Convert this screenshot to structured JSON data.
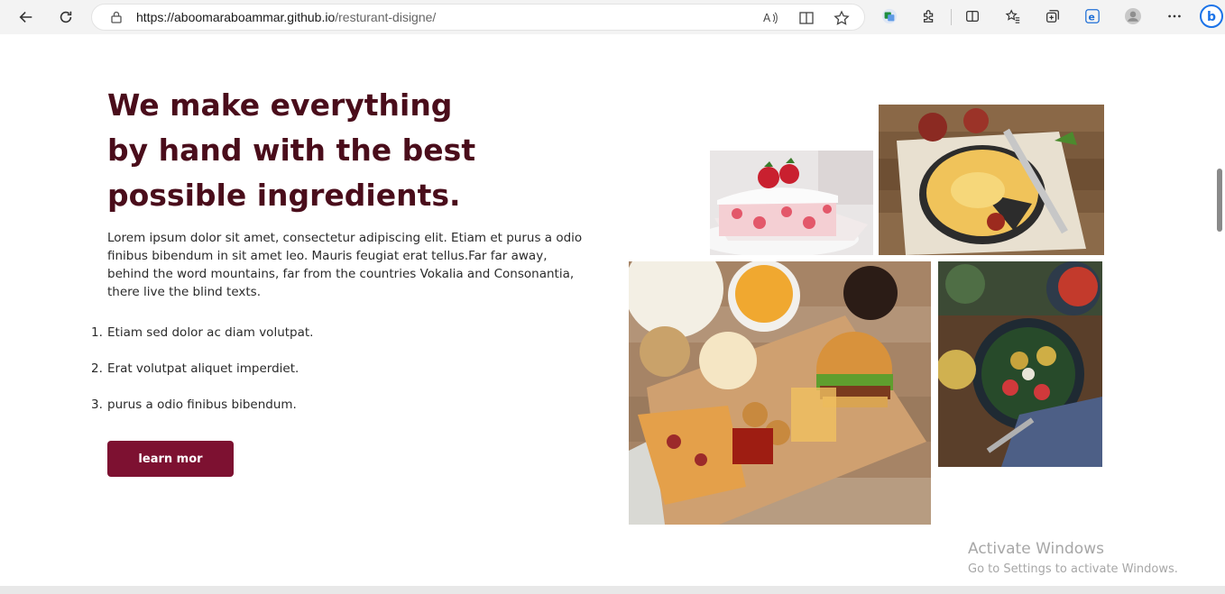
{
  "browser": {
    "url_host": "https://aboomaraboammar.github.io",
    "url_path": "/resturant-disigne/",
    "icons": [
      "back-icon",
      "refresh-icon",
      "lock-icon",
      "read-aloud-icon",
      "immersive-reader-icon",
      "favorite-star-icon",
      "translate-icon",
      "extensions-icon",
      "split-screen-icon",
      "favorites-icon",
      "collections-icon",
      "edge-icon",
      "profile-icon",
      "more-icon",
      "bing-icon"
    ]
  },
  "content": {
    "heading": "We make everything by hand with the best possible ingredients.",
    "paragraph": "Lorem ipsum dolor sit amet, consectetur adipiscing elit. Etiam et purus a odio finibus bibendum in sit amet leo. Mauris feugiat erat tellus.Far far away, behind the word mountains, far from the countries Vokalia and Consonantia, there live the blind texts.",
    "list": [
      {
        "num": "1.",
        "text": "Etiam sed dolor ac diam volutpat."
      },
      {
        "num": "2.",
        "text": "Erat volutpat aliquet imperdiet."
      },
      {
        "num": "3.",
        "text": "purus a odio finibus bibendum."
      }
    ],
    "button": "learn mor",
    "images": [
      "strawberry-cake-image",
      "pie-image",
      "fast-food-image",
      "salad-bowl-image"
    ]
  },
  "watermark": {
    "line1": "Activate Windows",
    "line2": "Go to Settings to activate Windows."
  },
  "colors": {
    "heading": "#4a0d1b",
    "button": "#7d1131"
  }
}
